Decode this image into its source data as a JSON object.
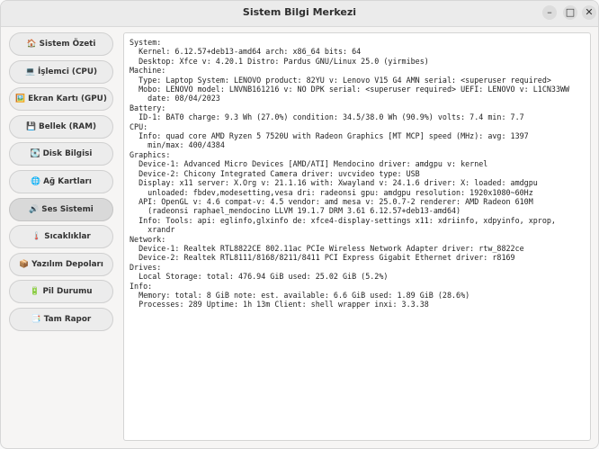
{
  "window": {
    "title": "Sistem Bilgi Merkezi",
    "minimize_glyph": "–",
    "maximize_glyph": "□",
    "close_glyph": "✕"
  },
  "sidebar": {
    "items": [
      {
        "label": "🏠 Sistem Özeti"
      },
      {
        "label": "💻 İşlemci (CPU)"
      },
      {
        "label": "🖼️ Ekran Kartı (GPU)"
      },
      {
        "label": "💾 Bellek (RAM)"
      },
      {
        "label": "💽 Disk Bilgisi"
      },
      {
        "label": "🌐 Ağ Kartları"
      },
      {
        "label": "🔊 Ses Sistemi"
      },
      {
        "label": "🌡️ Sıcaklıklar"
      },
      {
        "label": "📦 Yazılım Depoları"
      },
      {
        "label": "🔋 Pil Durumu"
      },
      {
        "label": "📑 Tam Rapor"
      }
    ],
    "active_index": 6
  },
  "output": {
    "lines": [
      "System:",
      "  Kernel: 6.12.57+deb13-amd64 arch: x86_64 bits: 64",
      "  Desktop: Xfce v: 4.20.1 Distro: Pardus GNU/Linux 25.0 (yirmibes)",
      "Machine:",
      "  Type: Laptop System: LENOVO product: 82YU v: Lenovo V15 G4 AMN serial: <superuser required>",
      "  Mobo: LENOVO model: LNVNB161216 v: NO DPK serial: <superuser required> UEFI: LENOVO v: L1CN33WW",
      "    date: 08/04/2023",
      "Battery:",
      "  ID-1: BAT0 charge: 9.3 Wh (27.0%) condition: 34.5/38.0 Wh (90.9%) volts: 7.4 min: 7.7",
      "CPU:",
      "  Info: quad core AMD Ryzen 5 7520U with Radeon Graphics [MT MCP] speed (MHz): avg: 1397",
      "    min/max: 400/4384",
      "Graphics:",
      "  Device-1: Advanced Micro Devices [AMD/ATI] Mendocino driver: amdgpu v: kernel",
      "  Device-2: Chicony Integrated Camera driver: uvcvideo type: USB",
      "  Display: x11 server: X.Org v: 21.1.16 with: Xwayland v: 24.1.6 driver: X: loaded: amdgpu",
      "    unloaded: fbdev,modesetting,vesa dri: radeonsi gpu: amdgpu resolution: 1920x1080~60Hz",
      "  API: OpenGL v: 4.6 compat-v: 4.5 vendor: amd mesa v: 25.0.7-2 renderer: AMD Radeon 610M",
      "    (radeonsi raphael_mendocino LLVM 19.1.7 DRM 3.61 6.12.57+deb13-amd64)",
      "  Info: Tools: api: eglinfo,glxinfo de: xfce4-display-settings x11: xdriinfo, xdpyinfo, xprop,",
      "    xrandr",
      "Network:",
      "  Device-1: Realtek RTL8822CE 802.11ac PCIe Wireless Network Adapter driver: rtw_8822ce",
      "  Device-2: Realtek RTL8111/8168/8211/8411 PCI Express Gigabit Ethernet driver: r8169",
      "Drives:",
      "  Local Storage: total: 476.94 GiB used: 25.02 GiB (5.2%)",
      "Info:",
      "  Memory: total: 8 GiB note: est. available: 6.6 GiB used: 1.89 GiB (28.6%)",
      "  Processes: 289 Uptime: 1h 13m Client: shell wrapper inxi: 3.3.38"
    ]
  }
}
